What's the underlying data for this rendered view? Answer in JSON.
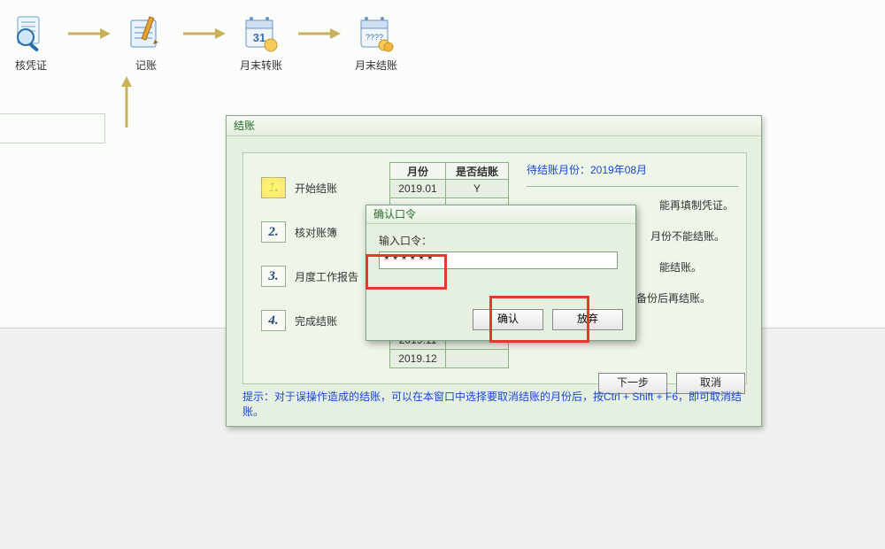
{
  "flow": {
    "n0": "核凭证",
    "n1": "记账",
    "n2": "月末转账",
    "n3": "月末结账"
  },
  "dialog": {
    "title": "结账",
    "steps": {
      "s1": "开始结账",
      "s2": "核对账簿",
      "s3": "月度工作报告",
      "s4": "完成结账"
    },
    "table": {
      "h1": "月份",
      "h2": "是否结账",
      "rows": [
        {
          "m": "2019.01",
          "y": "Y"
        },
        {
          "m": "2019.11",
          "y": ""
        },
        {
          "m": "2019.12",
          "y": ""
        }
      ]
    },
    "pending": "待结账月份：2019年08月",
    "notes": {
      "n1": "能再填制凭证。",
      "n2": "月份不能结账。",
      "n3": "能结账。",
      "n4": "数据备份后再结账。"
    },
    "next_btn": "下一步",
    "cancel_btn": "取消",
    "hint": "提示：对于误操作造成的结账，可以在本窗口中选择要取消结账的月份后，按Ctrl + Shift + F6，即可取消结账。"
  },
  "pwd": {
    "title": "确认口令",
    "label": "输入口令：",
    "value": "******",
    "ok": "确认",
    "cancel": "放弃"
  }
}
